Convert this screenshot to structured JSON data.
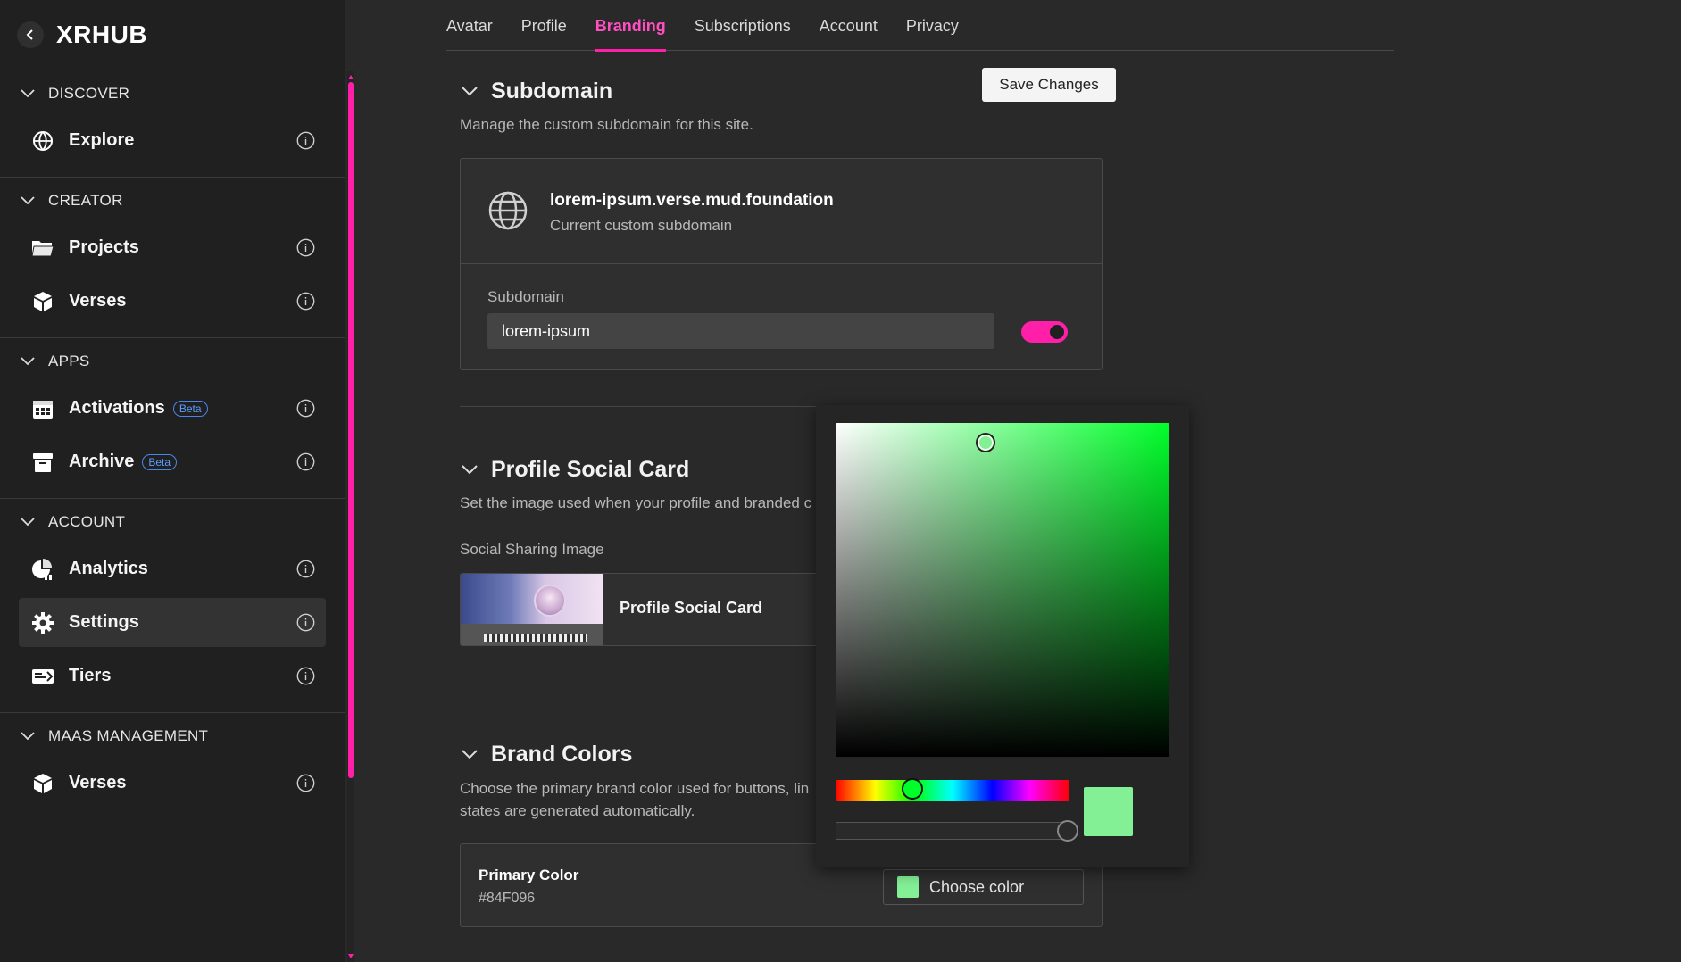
{
  "app": {
    "title": "XRHUB"
  },
  "sidebar": {
    "sections": [
      {
        "title": "DISCOVER",
        "items": [
          {
            "label": "Explore",
            "icon": "explore-icon"
          }
        ]
      },
      {
        "title": "CREATOR",
        "items": [
          {
            "label": "Projects",
            "icon": "folder-icon"
          },
          {
            "label": "Verses",
            "icon": "cube-icon"
          }
        ]
      },
      {
        "title": "APPS",
        "items": [
          {
            "label": "Activations",
            "icon": "calendar-icon",
            "badge": "Beta"
          },
          {
            "label": "Archive",
            "icon": "archive-icon",
            "badge": "Beta"
          }
        ]
      },
      {
        "title": "ACCOUNT",
        "items": [
          {
            "label": "Analytics",
            "icon": "analytics-icon"
          },
          {
            "label": "Settings",
            "icon": "gear-icon",
            "active": true
          },
          {
            "label": "Tiers",
            "icon": "ticket-icon"
          }
        ]
      },
      {
        "title": "MAAS MANAGEMENT",
        "items": [
          {
            "label": "Verses",
            "icon": "cube-icon"
          }
        ]
      }
    ]
  },
  "tabs": [
    {
      "label": "Avatar"
    },
    {
      "label": "Profile"
    },
    {
      "label": "Branding",
      "active": true
    },
    {
      "label": "Subscriptions"
    },
    {
      "label": "Account"
    },
    {
      "label": "Privacy"
    }
  ],
  "save_button": "Save Changes",
  "subdomain": {
    "title": "Subdomain",
    "description": "Manage the custom subdomain for this site.",
    "current_domain": "lorem-ipsum.verse.mud.foundation",
    "current_caption": "Current custom subdomain",
    "field_label": "Subdomain",
    "field_value": "lorem-ipsum",
    "toggle_on": true
  },
  "social_card": {
    "title": "Profile Social Card",
    "description": "Set the image used when your profile and branded c",
    "image_label": "Social Sharing Image",
    "image_name": "Profile Social Card"
  },
  "brand_colors": {
    "title": "Brand Colors",
    "description_line1": "Choose the primary brand color used for buttons, lin",
    "description_line2": "states are generated automatically.",
    "primary_label": "Primary Color",
    "primary_hex": "#84F096",
    "choose_label": "Choose color"
  },
  "color_picker": {
    "selected_color": "#84F096",
    "hue_color": "#00ff2a",
    "hue_fraction": 0.33,
    "saturation": 0.45,
    "value": 0.94,
    "alpha": 1.0
  },
  "colors": {
    "accent": "#ff1fa8",
    "background": "#292929",
    "sidebar": "#202020"
  }
}
